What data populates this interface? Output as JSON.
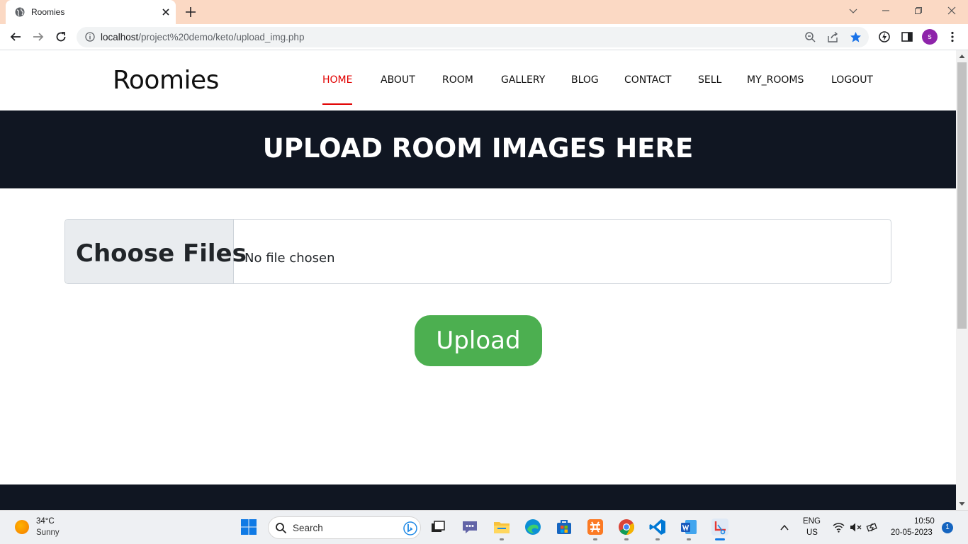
{
  "browser": {
    "tab_title": "Roomies",
    "url_host": "localhost",
    "url_path": "/project%20demo/keto/upload_img.php",
    "avatar_letter": "s",
    "accent": "#8e24aa"
  },
  "site": {
    "brand": "Roomies",
    "nav": [
      {
        "label": "HOME",
        "active": true
      },
      {
        "label": "ABOUT"
      },
      {
        "label": "ROOM"
      },
      {
        "label": "GALLERY"
      },
      {
        "label": "BLOG"
      },
      {
        "label": "CONTACT"
      },
      {
        "label": "SELL"
      },
      {
        "label": "MY_ROOMS"
      },
      {
        "label": "LOGOUT"
      }
    ],
    "active_color": "#e10000",
    "banner_title": "UPLOAD ROOM IMAGES HERE",
    "banner_color": "#101622"
  },
  "form": {
    "choose_label": "Choose Files",
    "file_status": "No file chosen",
    "upload_label": "Upload",
    "upload_color": "#4caf50"
  },
  "taskbar": {
    "temp": "34°C",
    "condition": "Sunny",
    "search_placeholder": "Search",
    "lang": "ENG",
    "region": "US",
    "time": "10:50",
    "date": "20-05-2023",
    "notifications": "1"
  }
}
